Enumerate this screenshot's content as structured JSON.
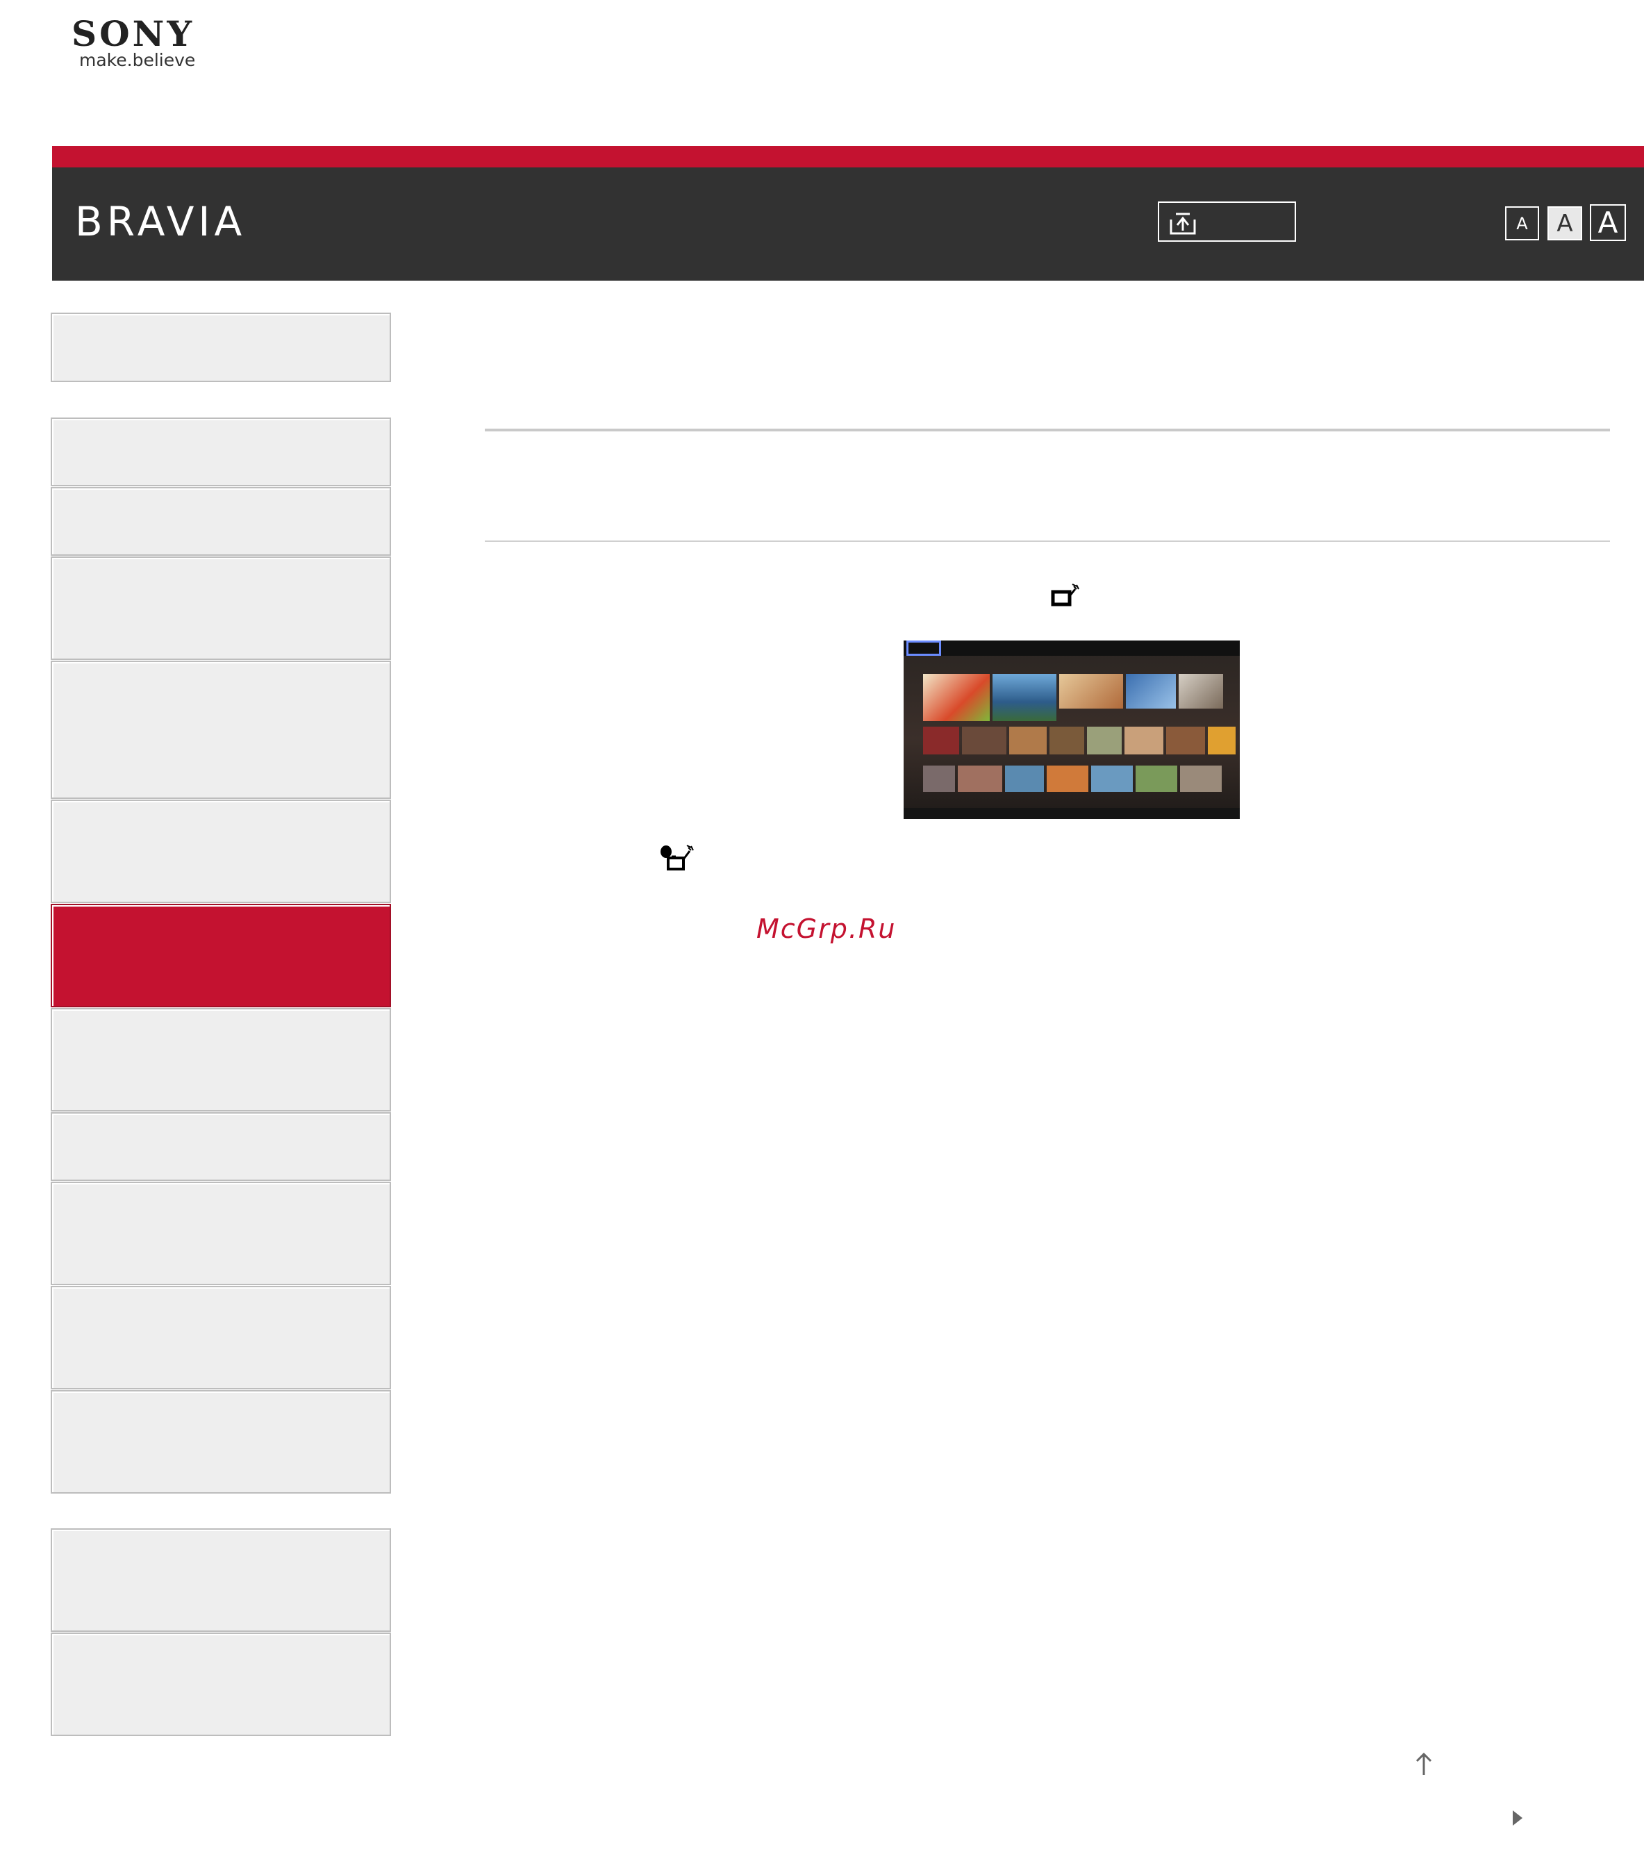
{
  "header": {
    "logo": "SONY",
    "tagline": "make.believe",
    "brand": "BRAVIA",
    "font_size_labels": [
      "A",
      "A",
      "A"
    ]
  },
  "sidebar": {
    "active_index": 7,
    "item_count": 15
  },
  "content": {
    "watermark": "McGrp.Ru"
  },
  "icons": {
    "search": "upload-search-icon",
    "inline_1": "tv-network-icon",
    "inline_2": "disc-tv-network-icon",
    "page_top": "arrow-up-icon",
    "next": "triangle-right-icon"
  },
  "colors": {
    "accent_red": "#c41230",
    "header_dark": "#323232",
    "nav_bg": "#eeeeee"
  }
}
